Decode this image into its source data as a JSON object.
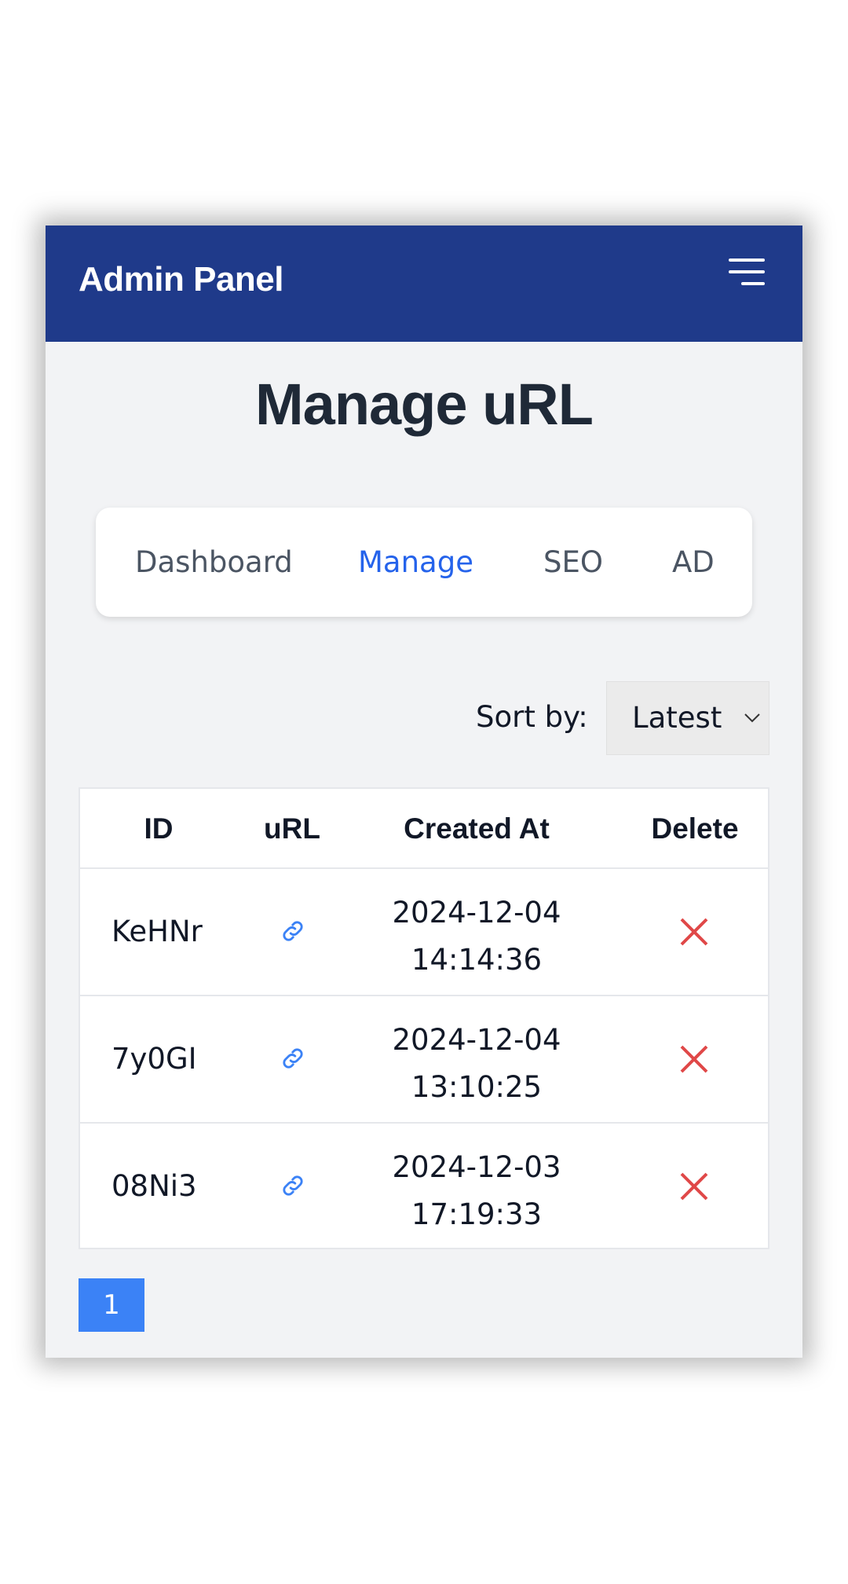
{
  "header": {
    "brand": "Admin Panel",
    "menu_icon": "hamburger-menu-icon",
    "background_color": "#1f3a8a"
  },
  "page": {
    "title": "Manage uRL"
  },
  "nav": {
    "items": [
      {
        "label": "Dashboard",
        "active": false
      },
      {
        "label": "Manage",
        "active": true
      },
      {
        "label": "SEO",
        "active": false
      },
      {
        "label": "AD",
        "active": false
      }
    ],
    "active_color": "#2563eb"
  },
  "sort": {
    "label": "Sort by:",
    "selected": "Latest"
  },
  "table": {
    "columns": [
      "ID",
      "uRL",
      "Created At",
      "Delete"
    ],
    "rows": [
      {
        "id": "KeHNr",
        "url_icon": "link-icon",
        "created_date": "2024-12-04",
        "created_time": "14:14:36",
        "delete_icon": "close-icon"
      },
      {
        "id": "7y0GI",
        "url_icon": "link-icon",
        "created_date": "2024-12-04",
        "created_time": "13:10:25",
        "delete_icon": "close-icon"
      },
      {
        "id": "08Ni3",
        "url_icon": "link-icon",
        "created_date": "2024-12-03",
        "created_time": "17:19:33",
        "delete_icon": "close-icon"
      }
    ],
    "link_color": "#3b82f6",
    "delete_color": "#e04848"
  },
  "pagination": {
    "current_page": "1"
  }
}
